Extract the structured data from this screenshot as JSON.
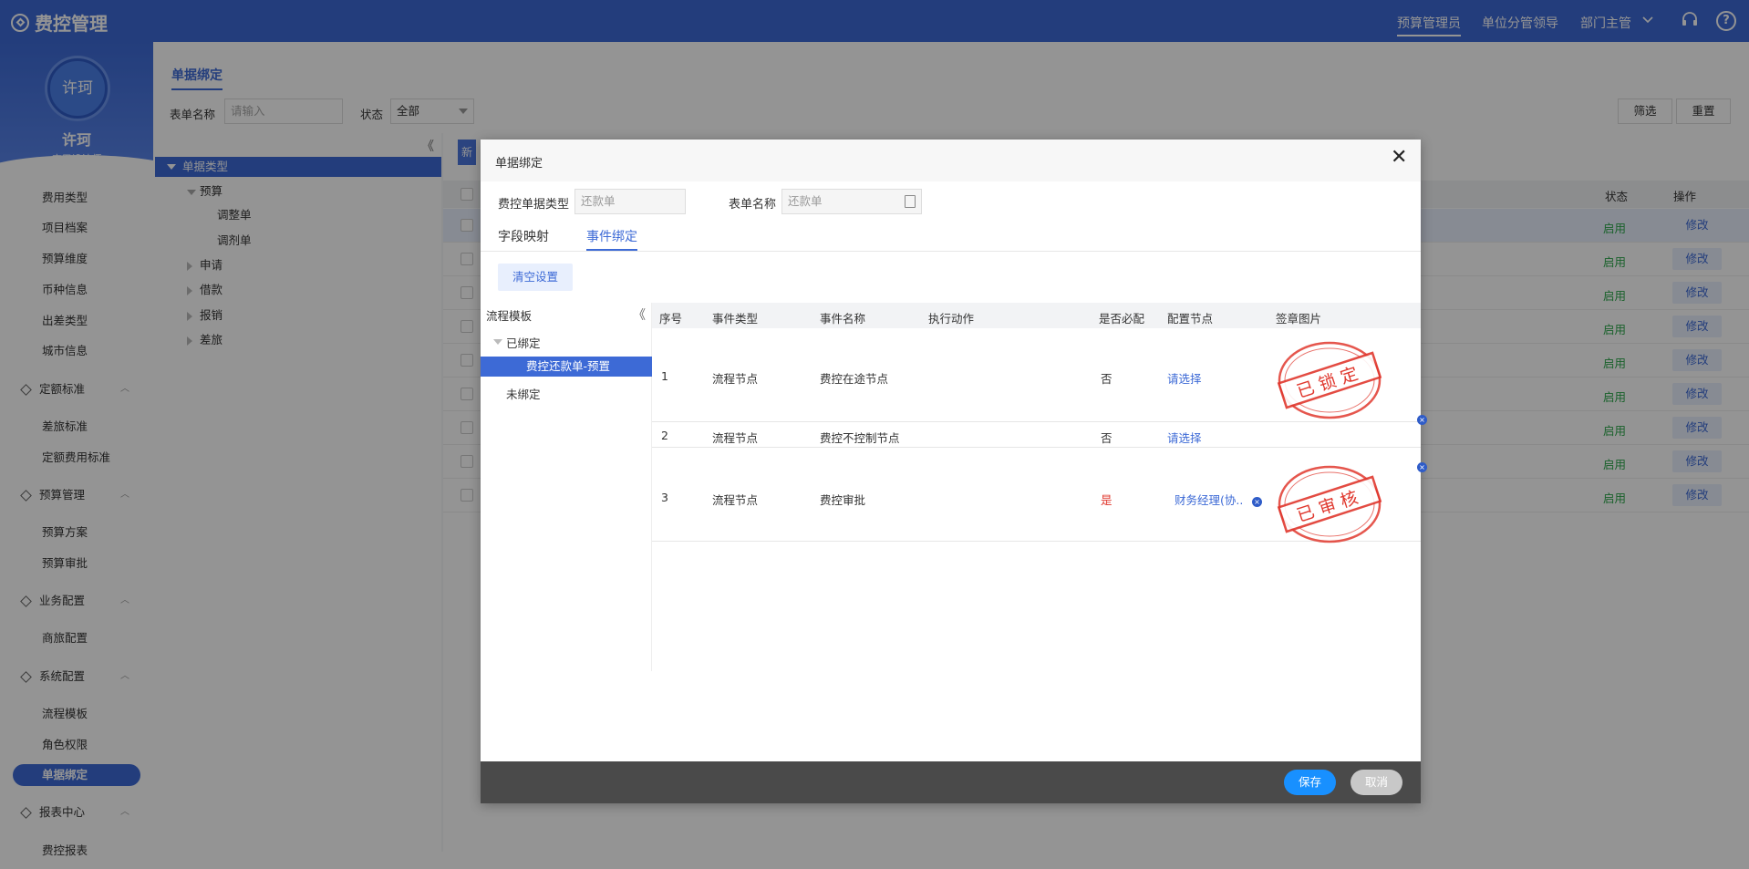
{
  "app": {
    "title": "费控管理"
  },
  "header": {
    "roles": [
      "预算管理员",
      "单位分管领导",
      "部门主管"
    ],
    "help": "?"
  },
  "user": {
    "avatar_text": "许珂",
    "name": "许珂",
    "role": "应用设计师"
  },
  "sidebar": {
    "items": [
      {
        "label": "费用类型"
      },
      {
        "label": "项目档案"
      },
      {
        "label": "预算维度"
      },
      {
        "label": "币种信息"
      },
      {
        "label": "出差类型"
      },
      {
        "label": "城市信息"
      },
      {
        "label": "定额标准"
      },
      {
        "label": "差旅标准"
      },
      {
        "label": "定额费用标准"
      },
      {
        "label": "预算管理"
      },
      {
        "label": "预算方案"
      },
      {
        "label": "预算审批"
      },
      {
        "label": "业务配置"
      },
      {
        "label": "商旅配置"
      },
      {
        "label": "系统配置"
      },
      {
        "label": "流程模板"
      },
      {
        "label": "角色权限"
      },
      {
        "label": "单据绑定"
      },
      {
        "label": "报表中心"
      },
      {
        "label": "费控报表"
      }
    ]
  },
  "page": {
    "tab": "单据绑定",
    "filter": {
      "name_label": "表单名称",
      "name_placeholder": "请输入",
      "status_label": "状态",
      "status_value": "全部",
      "search_btn": "筛选",
      "reset_btn": "重置"
    },
    "tree": {
      "root": "单据类型",
      "nodes": [
        "预算",
        "调整单",
        "调剂单",
        "申请",
        "借款",
        "报销",
        "差旅"
      ]
    },
    "table": {
      "status_header": "状态",
      "action_header": "操作",
      "status_value": "启用",
      "edit_label": "修改",
      "row_count": 9
    },
    "blue_tab_char": "新"
  },
  "modal": {
    "title": "单据绑定",
    "close": "✕",
    "doc_type_label": "费控单据类型",
    "doc_type_value": "还款单",
    "form_name_label": "表单名称",
    "form_name_value": "还款单",
    "tabs": [
      "字段映射",
      "事件绑定"
    ],
    "clear_btn": "清空设置",
    "left_tree": {
      "head": "流程模板",
      "collapse": "《",
      "bound": "已绑定",
      "selected": "费控还款单-预置",
      "unbound": "未绑定"
    },
    "grid": {
      "headers": [
        "序号",
        "事件类型",
        "事件名称",
        "执行动作",
        "是否必配",
        "配置节点",
        "签章图片"
      ],
      "rows": [
        {
          "no": "1",
          "type": "流程节点",
          "name": "费控在途节点",
          "action": "",
          "required": "否",
          "node": "请选择",
          "stamp": "已锁定"
        },
        {
          "no": "2",
          "type": "流程节点",
          "name": "费控不控制节点",
          "action": "",
          "required": "否",
          "node": "请选择",
          "stamp": ""
        },
        {
          "no": "3",
          "type": "流程节点",
          "name": "费控审批",
          "action": "",
          "required": "是",
          "node": "财务经理(协..",
          "stamp": "已审核"
        }
      ]
    },
    "save": "保存",
    "cancel": "取消"
  },
  "colors": {
    "primary": "#3d6ad6",
    "enabled": "#2ba84a",
    "stamp": "#e0382e"
  }
}
